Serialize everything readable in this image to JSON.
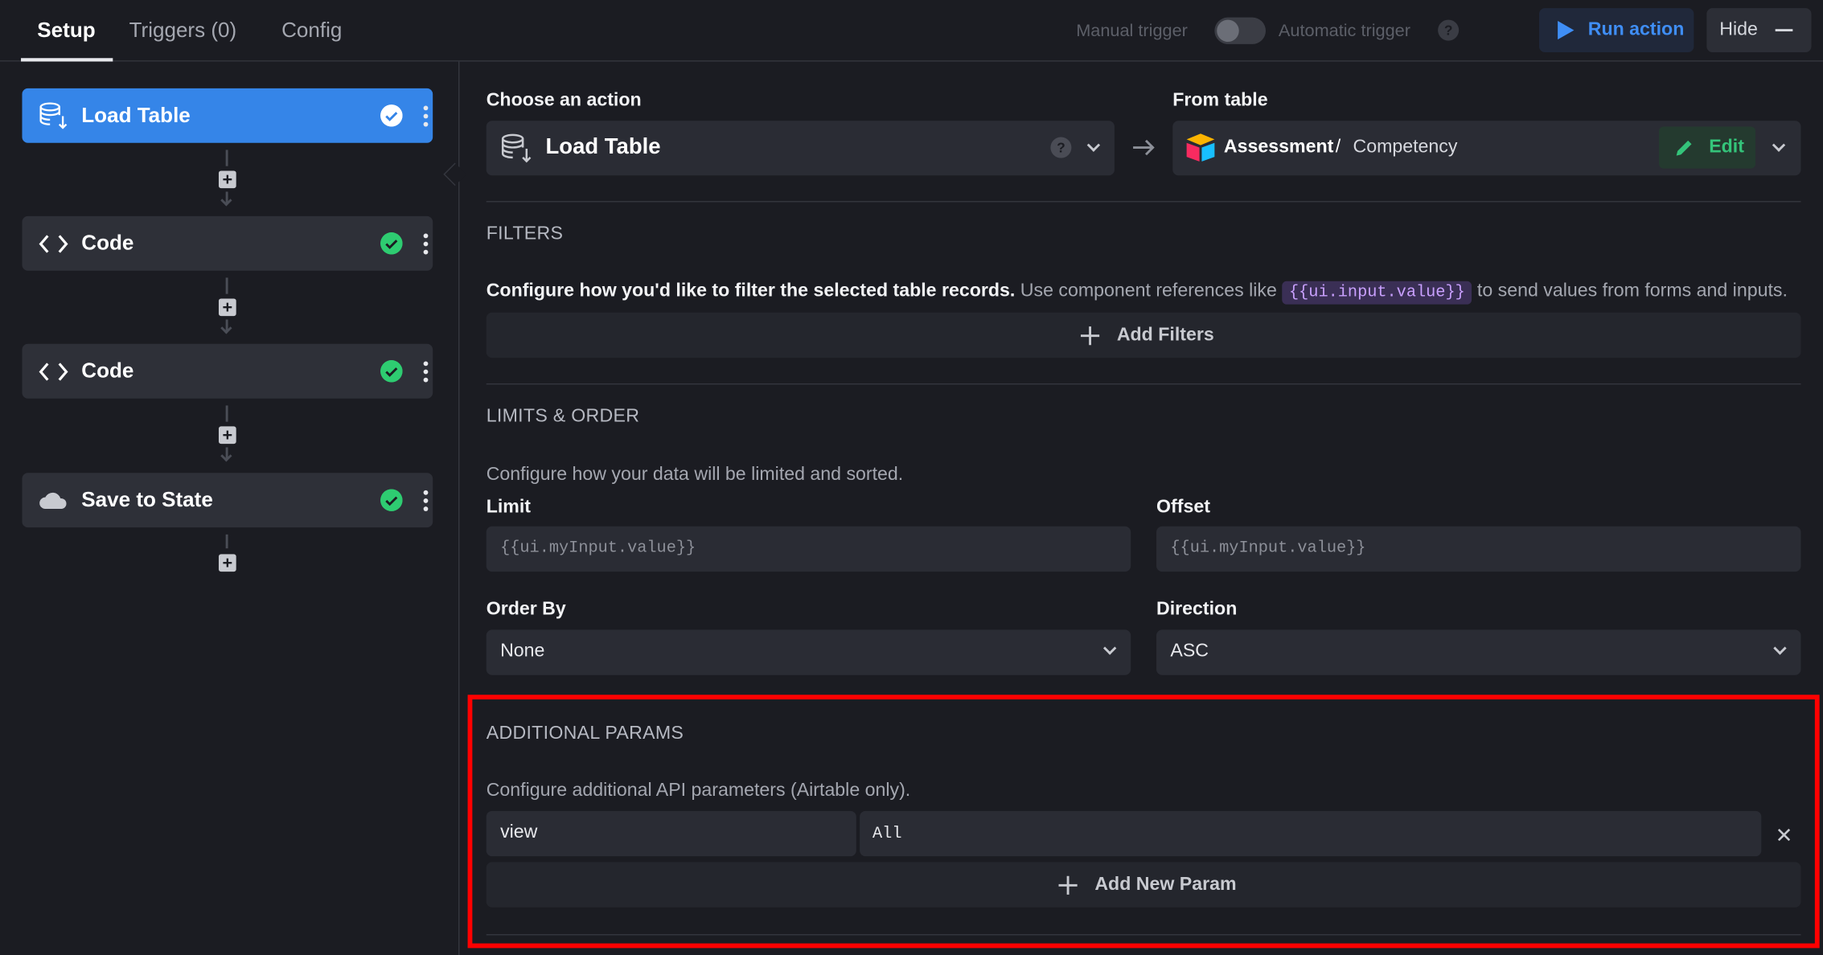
{
  "tabs": [
    {
      "label": "Setup",
      "active": true
    },
    {
      "label": "Triggers (0)",
      "active": false
    },
    {
      "label": "Config",
      "active": false
    }
  ],
  "header": {
    "manual_trigger_label": "Manual trigger",
    "automatic_trigger_label": "Automatic trigger",
    "help_mark": "?",
    "run_action_label": "Run action",
    "hide_label": "Hide",
    "accent_color": "#3585e8"
  },
  "sidebar": {
    "steps": [
      {
        "name": "Load Table",
        "icon": "database-download-icon",
        "active": true,
        "status": "success"
      },
      {
        "name": "Code",
        "icon": "code-brackets-icon",
        "active": false,
        "status": "success"
      },
      {
        "name": "Code",
        "icon": "code-brackets-icon",
        "active": false,
        "status": "success"
      },
      {
        "name": "Save to State",
        "icon": "cloud-icon",
        "active": false,
        "status": "success"
      }
    ]
  },
  "action": {
    "choose_label": "Choose an action",
    "selected": "Load Table",
    "help_mark": "?",
    "from_table_label": "From table",
    "table_base": "Assessment",
    "table_separator": "/",
    "table_name": "Competency",
    "edit_label": "Edit"
  },
  "filters": {
    "title": "FILTERS",
    "desc_bold": "Configure how you'd like to filter the selected table records.",
    "desc_pre": "Use component references like",
    "desc_code": "{{ui.input.value}}",
    "desc_post": "to send values from forms and inputs.",
    "add_label": "Add Filters"
  },
  "limits": {
    "title": "LIMITS & ORDER",
    "desc": "Configure how your data will be limited and sorted.",
    "limit_label": "Limit",
    "limit_placeholder": "{{ui.myInput.value}}",
    "offset_label": "Offset",
    "offset_placeholder": "{{ui.myInput.value}}",
    "order_by_label": "Order By",
    "order_by_value": "None",
    "direction_label": "Direction",
    "direction_value": "ASC"
  },
  "additional": {
    "title": "ADDITIONAL PARAMS",
    "desc": "Configure additional API parameters (Airtable only).",
    "param_key": "view",
    "param_value": "All",
    "remove_mark": "✕",
    "add_label": "Add New Param",
    "highlight_color": "#ff0000"
  }
}
